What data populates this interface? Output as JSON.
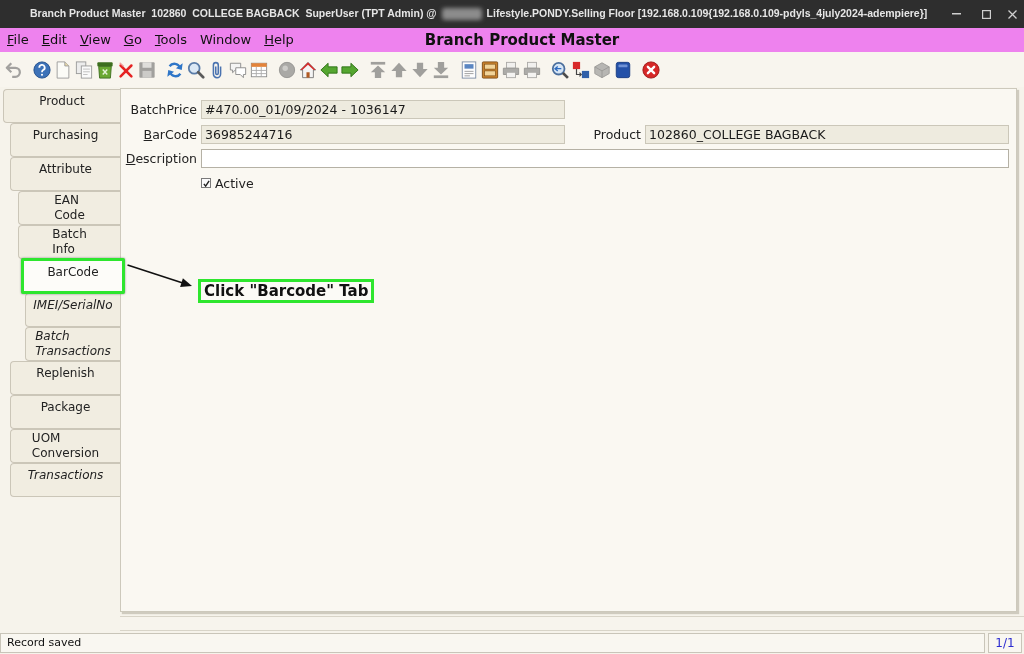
{
  "window": {
    "title": [
      "Branch Product Master  102860  COLLEGE BAGBACK  SuperUser (TPT Admin) @",
      "Lifestyle.PONDY.Selling Floor [192.168.0.109{192.168.0.109-pdyls_4july2024-adempiere}]"
    ]
  },
  "menu": [
    {
      "label": "File",
      "mnemonic": true
    },
    {
      "label": "Edit",
      "mnemonic": true
    },
    {
      "label": "View",
      "mnemonic": true
    },
    {
      "label": "Go",
      "mnemonic": true
    },
    {
      "label": "Tools",
      "mnemonic": true
    },
    {
      "label": "Window",
      "mnemonic": false
    },
    {
      "label": "Help",
      "mnemonic": true
    }
  ],
  "app_title": "Branch Product Master",
  "toolbar": [
    [
      {
        "kind": "undo",
        "disabled": true
      }
    ],
    [
      {
        "kind": "help",
        "disabled": false
      },
      {
        "kind": "new",
        "disabled": false
      },
      {
        "kind": "copy",
        "disabled": false
      },
      {
        "kind": "trash",
        "disabled": false
      },
      {
        "kind": "delete",
        "disabled": false
      },
      {
        "kind": "save",
        "disabled": true
      }
    ],
    [
      {
        "kind": "refresh",
        "disabled": false
      },
      {
        "kind": "find",
        "disabled": false
      },
      {
        "kind": "attachment",
        "disabled": false
      },
      {
        "kind": "chat",
        "disabled": false
      },
      {
        "kind": "grid",
        "disabled": false
      }
    ],
    [
      {
        "kind": "history",
        "disabled": true
      },
      {
        "kind": "home",
        "disabled": false
      },
      {
        "kind": "back",
        "disabled": false
      },
      {
        "kind": "forward",
        "disabled": false
      }
    ],
    [
      {
        "kind": "first",
        "disabled": true
      },
      {
        "kind": "previous",
        "disabled": true
      },
      {
        "kind": "next",
        "disabled": true
      },
      {
        "kind": "last",
        "disabled": true
      }
    ],
    [
      {
        "kind": "report",
        "disabled": false
      },
      {
        "kind": "archive",
        "disabled": false
      },
      {
        "kind": "print",
        "disabled": true
      },
      {
        "kind": "print",
        "disabled": true
      }
    ],
    [
      {
        "kind": "zoom_across",
        "disabled": false
      },
      {
        "kind": "workflow",
        "disabled": false
      },
      {
        "kind": "product_info",
        "disabled": true
      },
      {
        "kind": "request",
        "disabled": false
      }
    ],
    [
      {
        "kind": "exit",
        "disabled": false
      }
    ]
  ],
  "tabs": [
    {
      "label": "Product",
      "selected": false,
      "read_only": false,
      "highlighted": false,
      "children": [
        {
          "label": "Purchasing",
          "selected": false,
          "read_only": false,
          "highlighted": false
        },
        {
          "label": "Attribute",
          "selected": false,
          "read_only": false,
          "highlighted": false,
          "children": [
            {
              "label": "EAN\nCode",
              "selected": false,
              "read_only": false,
              "highlighted": false
            },
            {
              "label": "Batch\nInfo",
              "selected": false,
              "read_only": false,
              "highlighted": false
            },
            {
              "label": "BarCode",
              "selected": true,
              "read_only": false,
              "highlighted": true,
              "children": [
                {
                  "label": "IMEI/SerialNo",
                  "selected": false,
                  "read_only": true,
                  "highlighted": false
                },
                {
                  "label": "Batch\nTransactions",
                  "selected": false,
                  "read_only": true,
                  "highlighted": false
                }
              ]
            }
          ]
        },
        {
          "label": "Replenish",
          "selected": false,
          "read_only": false,
          "highlighted": false
        },
        {
          "label": "Package",
          "selected": false,
          "read_only": false,
          "highlighted": false
        },
        {
          "label": "UOM\nConversion",
          "selected": false,
          "read_only": false,
          "highlighted": false
        },
        {
          "label": "Transactions",
          "selected": false,
          "read_only": true,
          "highlighted": false
        }
      ]
    }
  ],
  "form": {
    "rows": [
      [
        {
          "kind": "text",
          "label": "BatchPrice",
          "mnemonic": false,
          "value": "#470.00_01/09/2024 - 1036147",
          "read_only": true
        }
      ],
      [
        {
          "kind": "text",
          "label": "BarCode",
          "mnemonic": true,
          "value": "36985244716",
          "read_only": true
        },
        {
          "kind": "text",
          "label": "Product",
          "mnemonic": false,
          "value": "102860_COLLEGE BAGBACK",
          "read_only": true
        }
      ],
      [
        {
          "kind": "long_text",
          "label": "Description",
          "mnemonic": true,
          "read_only": false
        }
      ],
      [
        {
          "kind": "checkbox",
          "label": "Active",
          "checked": true
        }
      ]
    ]
  },
  "annotation": {
    "text": "Click \"Barcode\" Tab"
  },
  "status_bar": {
    "message": "Record saved",
    "record_count": "1/1"
  }
}
